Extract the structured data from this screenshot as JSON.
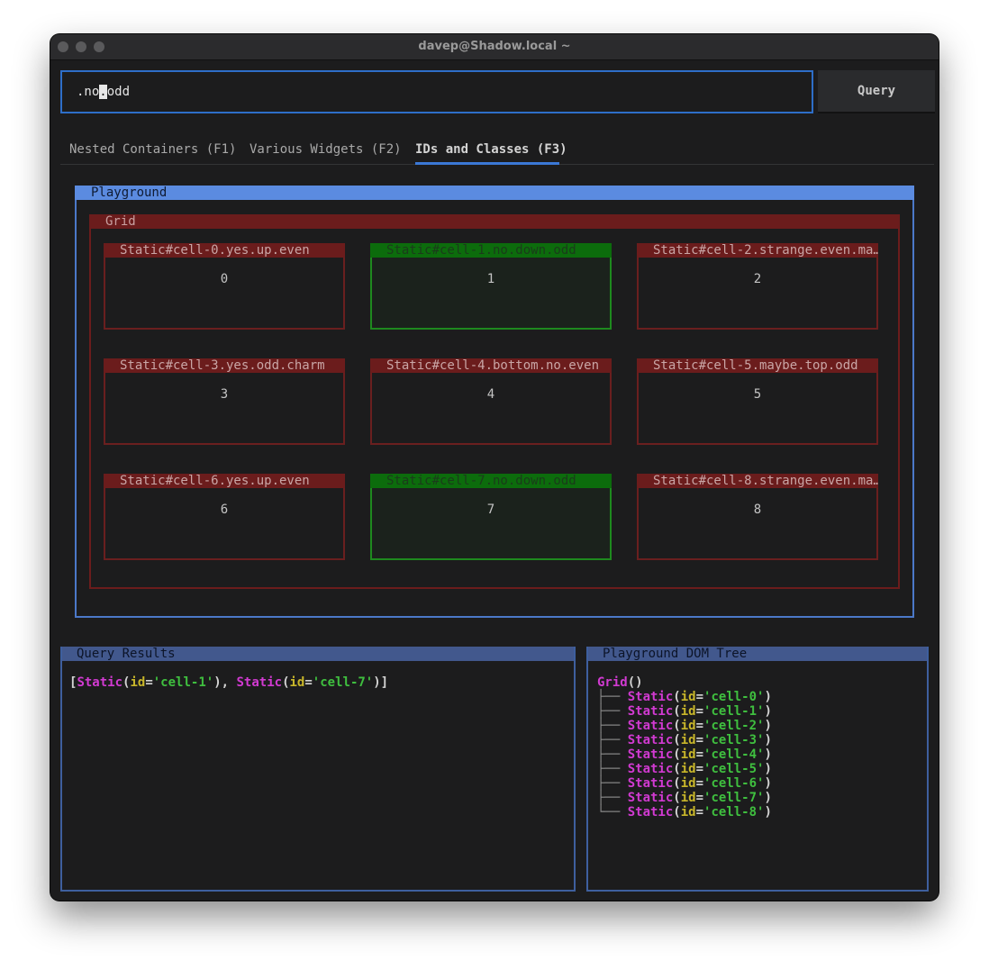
{
  "window": {
    "title": "davep@Shadow.local ~"
  },
  "query": {
    "value_before": ".no",
    "value_cursor": ".",
    "value_after": "odd",
    "button_label": "Query"
  },
  "tabs": [
    {
      "label": "Nested Containers (F1)",
      "active": false
    },
    {
      "label": "Various Widgets (F2)",
      "active": false
    },
    {
      "label": "IDs and Classes (F3)",
      "active": true
    }
  ],
  "playground": {
    "title": "Playground",
    "grid": {
      "title": "Grid",
      "cells": [
        {
          "title": "Static#cell-0.yes.up.even",
          "value": "0",
          "selected": false
        },
        {
          "title": "Static#cell-1.no.down.odd",
          "value": "1",
          "selected": true
        },
        {
          "title": "Static#cell-2.strange.even.ma…",
          "value": "2",
          "selected": false
        },
        {
          "title": "Static#cell-3.yes.odd.charm",
          "value": "3",
          "selected": false
        },
        {
          "title": "Static#cell-4.bottom.no.even",
          "value": "4",
          "selected": false
        },
        {
          "title": "Static#cell-5.maybe.top.odd",
          "value": "5",
          "selected": false
        },
        {
          "title": "Static#cell-6.yes.up.even",
          "value": "6",
          "selected": false
        },
        {
          "title": "Static#cell-7.no.down.odd",
          "value": "7",
          "selected": true
        },
        {
          "title": "Static#cell-8.strange.even.ma…",
          "value": "8",
          "selected": false
        }
      ]
    }
  },
  "results": {
    "title": "Query Results",
    "items": [
      {
        "type": "Static",
        "attr": "id",
        "value": "'cell-1'"
      },
      {
        "type": "Static",
        "attr": "id",
        "value": "'cell-7'"
      }
    ]
  },
  "dom_tree": {
    "title": "Playground DOM Tree",
    "root": "Grid",
    "children": [
      {
        "guide": "├── ",
        "type": "Static",
        "attr": "id",
        "value": "'cell-0'"
      },
      {
        "guide": "├── ",
        "type": "Static",
        "attr": "id",
        "value": "'cell-1'"
      },
      {
        "guide": "├── ",
        "type": "Static",
        "attr": "id",
        "value": "'cell-2'"
      },
      {
        "guide": "├── ",
        "type": "Static",
        "attr": "id",
        "value": "'cell-3'"
      },
      {
        "guide": "├── ",
        "type": "Static",
        "attr": "id",
        "value": "'cell-4'"
      },
      {
        "guide": "├── ",
        "type": "Static",
        "attr": "id",
        "value": "'cell-5'"
      },
      {
        "guide": "├── ",
        "type": "Static",
        "attr": "id",
        "value": "'cell-6'"
      },
      {
        "guide": "├── ",
        "type": "Static",
        "attr": "id",
        "value": "'cell-7'"
      },
      {
        "guide": "└── ",
        "type": "Static",
        "attr": "id",
        "value": "'cell-8'"
      }
    ]
  },
  "colors": {
    "accent": "#2e6ec8",
    "playground_border": "#5b8be0",
    "grid_border": "#6b1c1c",
    "selected_cell": "#0c6c0c",
    "type_color": "#d13ad1",
    "attr_color": "#c8b62a",
    "string_color": "#3fbf3f"
  }
}
